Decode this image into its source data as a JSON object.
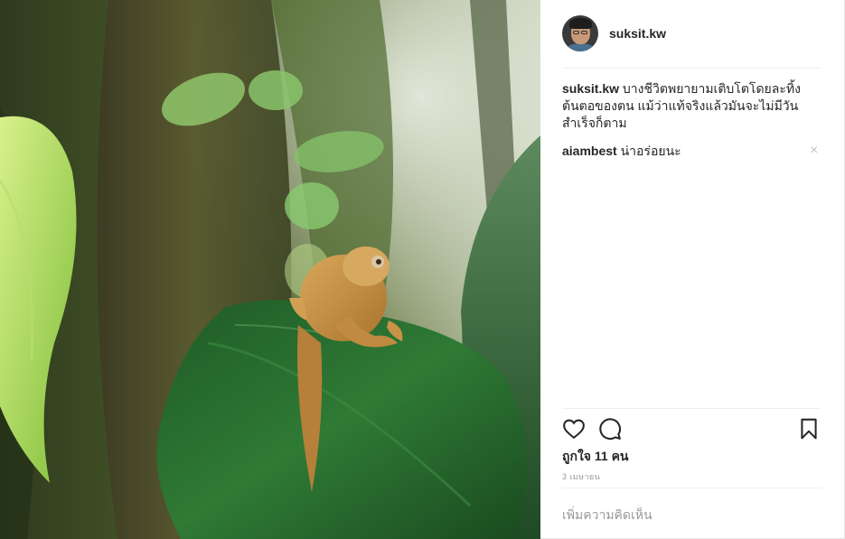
{
  "post": {
    "username": "suksit.kw",
    "caption_user": "suksit.kw",
    "caption_text": "บางชีวิตพยายามเติบโตโดยละทิ้งต้นตอของตน แม้ว่าแท้จริงแล้วมันจะไม่มีวันสำเร็จก็ตาม",
    "comments": [
      {
        "user": "aiambest",
        "text": "น่าอร่อยนะ"
      }
    ],
    "likes_label": "ถูกใจ 11 คน",
    "date_label": "3 เมษายน",
    "add_comment_placeholder": "เพิ่มความคิดเห็น",
    "close_symbol": "×"
  },
  "icons": {
    "avatar": "avatar-photo",
    "like": "heart-icon",
    "comment": "comment-bubble-icon",
    "save": "bookmark-icon",
    "delete": "close-icon"
  },
  "photo": {
    "subject": "frog-on-leaf"
  }
}
